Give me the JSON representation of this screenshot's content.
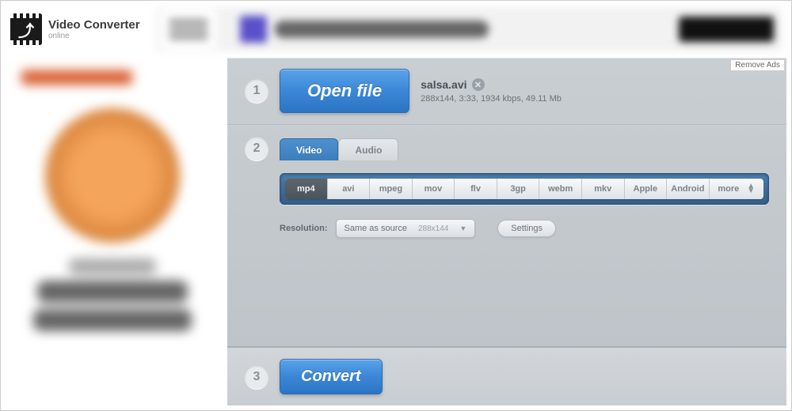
{
  "header": {
    "title": "Video Converter",
    "subtitle": "online"
  },
  "remove_ads_label": "Remove Ads",
  "step1": {
    "num": "1",
    "open_label": "Open file",
    "filename": "salsa.avi",
    "meta": "288x144, 3:33, 1934 kbps, 49.11 Mb"
  },
  "step2": {
    "num": "2",
    "tabs": {
      "video": "Video",
      "audio": "Audio"
    },
    "formats": {
      "mp4": "mp4",
      "avi": "avi",
      "mpeg": "mpeg",
      "mov": "mov",
      "flv": "flv",
      "3gp": "3gp",
      "webm": "webm",
      "mkv": "mkv",
      "apple": "Apple",
      "android": "Android",
      "more": "more"
    },
    "resolution_label": "Resolution:",
    "resolution_value": "Same as source",
    "resolution_dim": "288x144",
    "settings_label": "Settings"
  },
  "step3": {
    "num": "3",
    "convert_label": "Convert"
  }
}
